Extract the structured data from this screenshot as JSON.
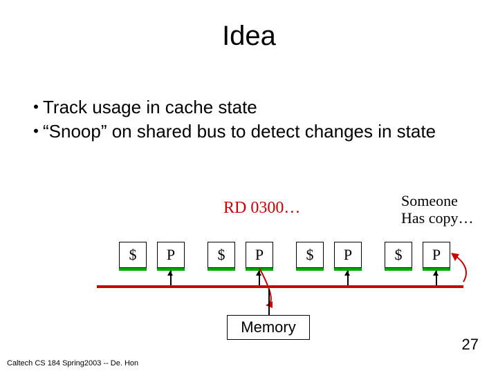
{
  "title": "Idea",
  "bullets": [
    "Track usage in cache state",
    "“Snoop” on shared bus to detect changes in state"
  ],
  "rd_label": "RD 0300…",
  "someone_label_line1": "Someone",
  "someone_label_line2": "Has copy…",
  "box_cache": "$",
  "box_proc": "P",
  "memory_label": "Memory",
  "footer_left": "Caltech CS 184 Spring2003 -- De. Hon",
  "footer_right": "27",
  "pairs_x": [
    172,
    300,
    428,
    556
  ]
}
